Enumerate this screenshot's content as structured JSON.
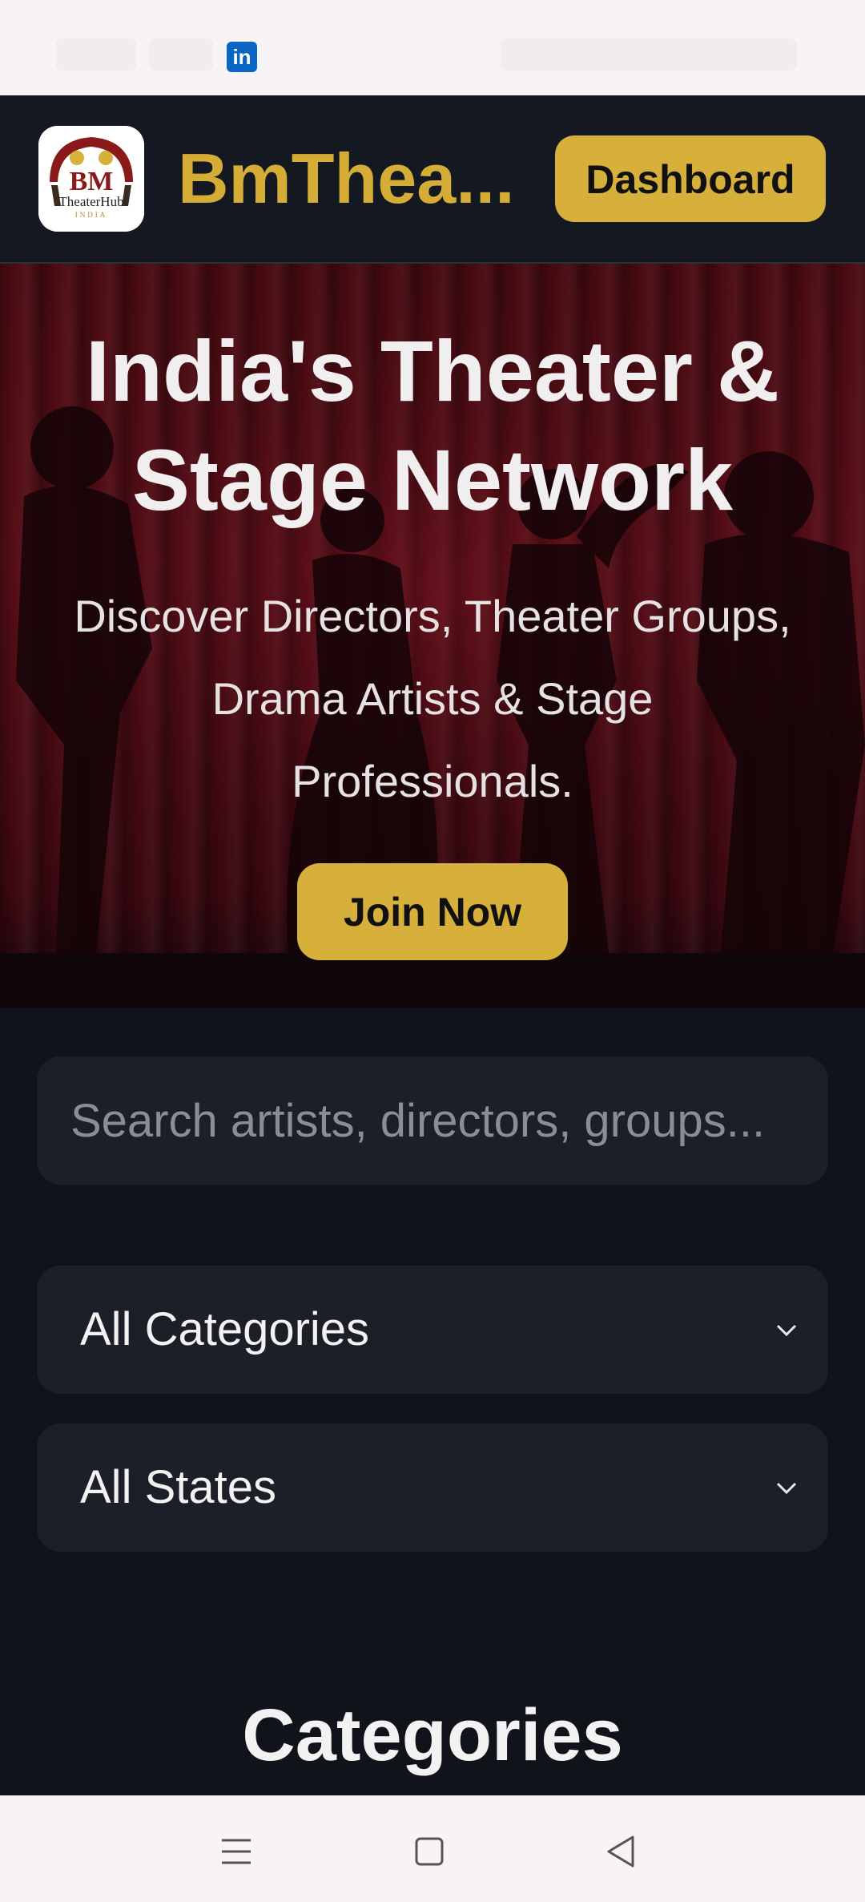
{
  "status_bar": {
    "linkedin_badge": "in"
  },
  "header": {
    "logo_text_top": "BM",
    "logo_text_main": "TheaterHub",
    "logo_text_sub": "INDIA",
    "site_title": "BmThea...",
    "dashboard_label": "Dashboard"
  },
  "hero": {
    "title": "India's Theater & Stage Network",
    "subtitle": "Discover Directors, Theater Groups, Drama Artists & Stage Professionals.",
    "join_label": "Join Now"
  },
  "filters": {
    "search_placeholder": "Search artists, directors, groups...",
    "category_value": "All Categories",
    "state_value": "All States"
  },
  "sections": {
    "categories_heading": "Categories"
  },
  "colors": {
    "accent": "#d6b03a",
    "header_bg": "#141820",
    "page_bg": "#11131a",
    "curtain": "#5a0e18"
  },
  "icons": [
    "linkedin-icon",
    "chevron-down-icon",
    "menu-icon",
    "home-icon",
    "back-icon"
  ]
}
